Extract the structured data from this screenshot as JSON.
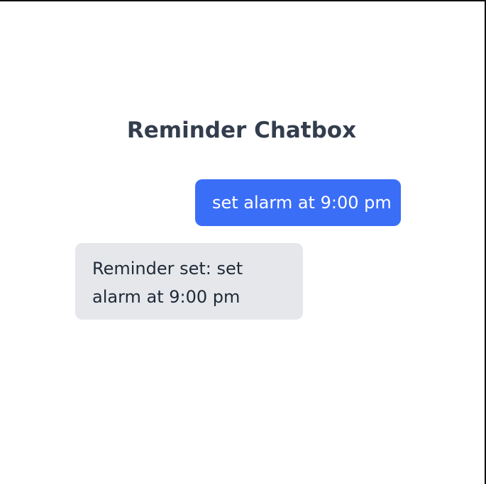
{
  "chatbox": {
    "title": "Reminder Chatbox",
    "messages": [
      {
        "sender": "user",
        "text": "set alarm at 9:00 pm"
      },
      {
        "sender": "bot",
        "text": "Reminder set: set alarm at 9:00 pm"
      }
    ]
  },
  "colors": {
    "user_bubble": "#3b6ef7",
    "bot_bubble": "#e5e7eb",
    "title_text": "#333d4d"
  }
}
